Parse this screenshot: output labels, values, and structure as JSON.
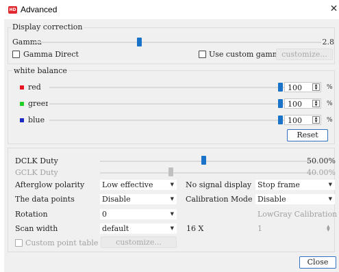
{
  "window": {
    "icon_text": "HD",
    "title": "Advanced",
    "close_glyph": "✕"
  },
  "display_correction": {
    "title": "Display correction",
    "gamma_label": "Gamma",
    "gamma_value": "2.8",
    "gamma_level_percent": 36,
    "gamma_direct_label": "Gamma Direct",
    "gamma_direct_checked": false,
    "use_custom_gamma_label": "Use custom gamma",
    "use_custom_gamma_checked": false,
    "customize_label": "customize..."
  },
  "white_balance": {
    "title": "white balance",
    "channels": [
      {
        "label": "red",
        "value": "100",
        "color": "#e8141b",
        "level_percent": 100
      },
      {
        "label": "greer",
        "value": "100",
        "color": "#22d022",
        "level_percent": 100
      },
      {
        "label": "blue",
        "value": "100",
        "color": "#1e28c8",
        "level_percent": 100
      }
    ],
    "unit": "%",
    "reset_label": "Reset"
  },
  "advanced": {
    "dclk_duty_label": "DCLK Duty",
    "dclk_duty_value": "50.00%",
    "dclk_level_percent": 50,
    "gclk_duty_label": "GCLK Duty",
    "gclk_duty_value": "40.00%",
    "gclk_level_percent": 40,
    "afterglow_label": "Afterglow polarity",
    "afterglow_value": "Low effective",
    "no_signal_label": "No signal display",
    "no_signal_value": "Stop frame",
    "data_points_label": "The data points",
    "data_points_value": "Disable",
    "calibration_label": "Calibration Mode",
    "calibration_value": "Disable",
    "rotation_label": "Rotation",
    "rotation_value": "0",
    "lowgray_label": "LowGray Calibration",
    "scan_width_label": "Scan width",
    "scan_width_value": "default",
    "scan_x_label": "16 X",
    "scan_x_value": "1",
    "custom_point_table_label": "Custom point table",
    "custom_point_table_checked": false,
    "customize_label": "customize..."
  },
  "footer": {
    "close_label": "Close"
  },
  "colors": {
    "accent": "#1a73c8",
    "window_bg": "#f0f0f0",
    "app_icon": "#e0282e"
  }
}
